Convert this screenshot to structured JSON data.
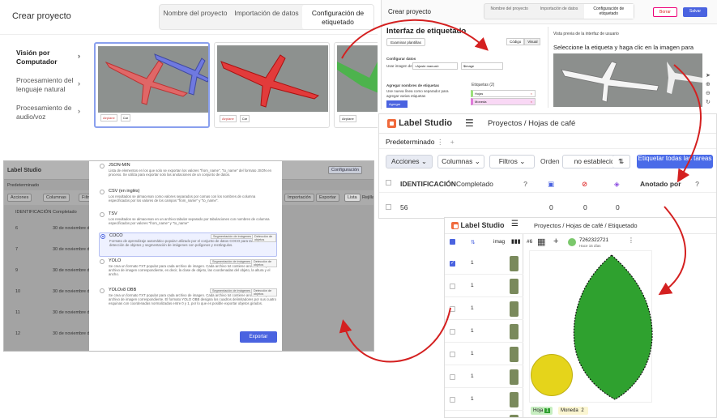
{
  "panelA": {
    "title": "Crear proyecto",
    "tabs": [
      "Nombre del proyecto",
      "Importación de datos",
      "Configuración de etiquetado"
    ],
    "sidebar": [
      "Visión por Computador",
      "Procesamiento del lenguaje natural",
      "Procesamiento de audio/voz"
    ],
    "thumb_labels": [
      "Airplane",
      "Car"
    ]
  },
  "panelB": {
    "title": "Crear proyecto",
    "tabs": [
      "Nombre del proyecto",
      "Importación de datos",
      "Configuración de etiquetado"
    ],
    "cancel": "Borrar",
    "save": "Salvar",
    "heading": "Interfaz de etiquetado",
    "browse": "Examinar plantillas",
    "code": "Código",
    "visual": "Visual",
    "config_data": "Configurar datos",
    "use_image": "Usar imagen de",
    "manual": "<Ajuste manual>",
    "image_var": "$image",
    "add_labels": "Agregar nombres de etiquetas",
    "add_hint": "Use nueva línea como separador para agregar varias etiquetas",
    "labels_title": "Etiquetas (2)",
    "labels": [
      "Hojas",
      "Moneda"
    ],
    "add_btn": "Agregar",
    "preview_title": "Vista previa de la interfaz de usuario",
    "preview_sub": "Seleccione la etiqueta y haga clic en la imagen para comenzar"
  },
  "panelC": {
    "brand": "Label Studio",
    "breadcrumb": "Proyectos / Hojas de café",
    "tab": "Predeterminado",
    "actions": "Acciones",
    "columns": "Columnas",
    "filters": "Filtros",
    "order": "Orden",
    "order_value": "no establecido",
    "label_all": "Etiquetar todas las tareas",
    "headers": [
      "IDENTIFICACIÓN",
      "Completado",
      "Anotado por"
    ],
    "row": {
      "id": "56",
      "c1": "0",
      "c2": "0",
      "c3": "0"
    }
  },
  "panelD": {
    "brand": "Label Studio",
    "settings": "Configuración",
    "tab": "Predeterminado",
    "actions": "Acciones",
    "columns": "Columnas",
    "filters": "Filtros",
    "import": "Importación",
    "export": "Exportar",
    "list": "Lista",
    "grid": "Rejilla",
    "id_col": "IDENTIFICACIÓN",
    "done_col": "Completado",
    "ids": [
      "6",
      "7",
      "9",
      "10",
      "11",
      "12"
    ],
    "date": "30 de noviembre de",
    "options": [
      {
        "name": "JSON-MIN",
        "desc": "Lista de elementos en los que solo se exportan los valores \"from_name\", \"to_name\" del formato JSON en proceso. Se utiliza para exportar solo las anotaciones de un conjunto de datos."
      },
      {
        "name": "CSV (en inglés)",
        "desc": "Los resultados se almacenan como valores separados por comas con los nombres de columna especificados por los valores de los campos \"from_name\" y \"to_name\"."
      },
      {
        "name": "TSV",
        "desc": "Los resultados se almacenan en un archivo tabular separado por tabulaciones con nombres de columna especificados por valores \"from_name\" y \"to_name\""
      },
      {
        "name": "COCO",
        "desc": "Formato de aprendizaje automático popular utilizado por el conjunto de datos COCO para tareas de detección de objetos y segmentación de imágenes con polígonos y rectángulos.",
        "tags": [
          "Segmentación de imágenes",
          "Detección de objetos"
        ]
      },
      {
        "name": "YOLO",
        "desc": "Se crea un formato TXT popular para cada archivo de imagen. Cada archivo txt contiene anotaciones para el archivo de imagen correspondiente, es decir, la clase de objeto, las coordenadas del objeto, la altura y el ancho.",
        "tags": [
          "Segmentación de imágenes",
          "Detección de objetos"
        ]
      },
      {
        "name": "YOLOv8 OBB",
        "desc": "Se crea un formato TXT popular para cada archivo de imagen. Cada archivo txt contiene anotaciones para el archivo de imagen correspondiente. El formato YOLO OBB designa los cuadros delimitadores por sus cuatro esquinas con coordenadas normalizadas entre 0 y 1, por lo que es posible exportar objetos girados.",
        "tags": [
          "Segmentación de imágenes",
          "Detección de objetos"
        ]
      }
    ],
    "export_btn": "Exportar"
  },
  "panelE": {
    "brand": "Label Studio",
    "breadcrumb": "Proyectos / Hojas de café / Etiquetado",
    "task": "#6",
    "user": "7262322721",
    "ago": "Hace 15 días",
    "col": "imag",
    "rows": [
      "1",
      "1",
      "1",
      "1",
      "1",
      "1",
      "1",
      "1"
    ],
    "labels": [
      {
        "name": "Hoja",
        "count": "1"
      },
      {
        "name": "Moneda",
        "count": "2"
      }
    ]
  },
  "colors": {
    "accent": "#4a63e0",
    "brand": "#f06a3c",
    "arrow": "#d42020",
    "leaf": "#2fa12f",
    "coin": "#e5d41b"
  }
}
